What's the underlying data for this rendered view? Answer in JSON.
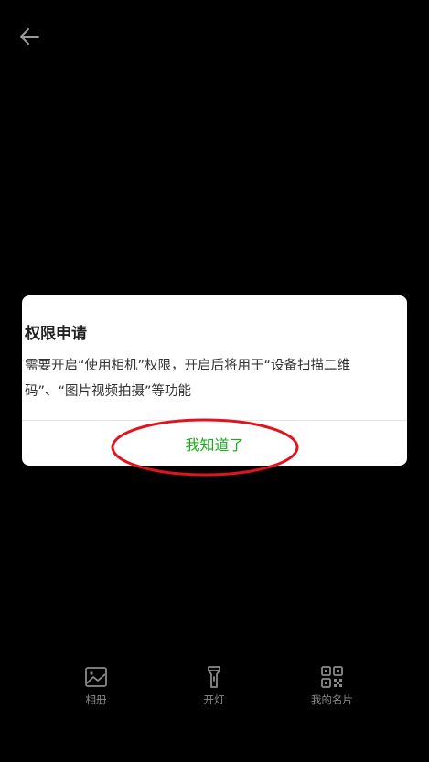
{
  "dialog": {
    "title": "权限申请",
    "message": "需要开启“使用相机”权限，开启后将用于“设备扫描二维码”、“图片视频拍摄”等功能",
    "confirm_label": "我知道了"
  },
  "toolbar": {
    "album_label": "相册",
    "flashlight_label": "开灯",
    "my_card_label": "我的名片"
  },
  "colors": {
    "accent": "#1aad19",
    "annotation": "#e0141e",
    "background": "#000000"
  }
}
